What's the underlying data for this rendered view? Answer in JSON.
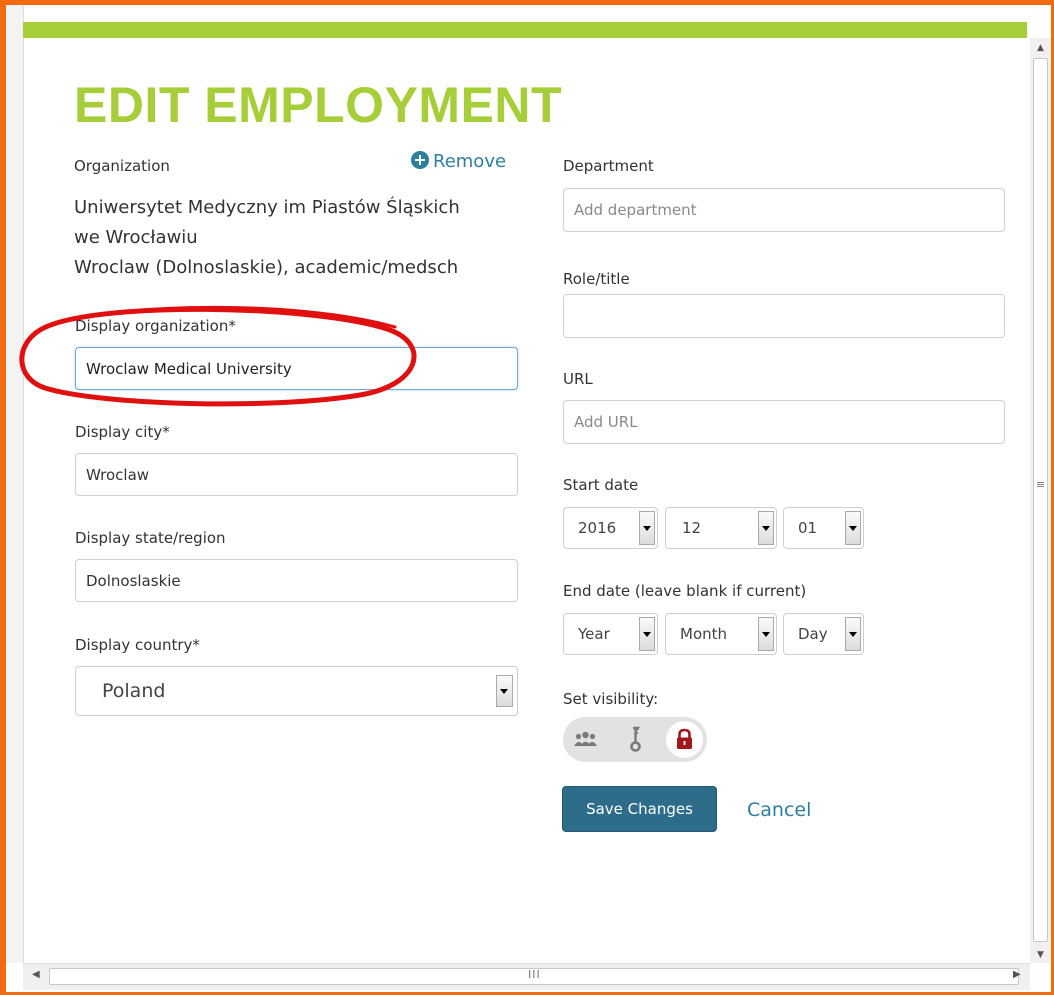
{
  "dialog": {
    "title": "EDIT EMPLOYMENT"
  },
  "organization": {
    "label": "Organization",
    "remove_label": "Remove",
    "name_line1": "Uniwersytet Medyczny im Piastów Śląskich",
    "name_line2": "we Wrocławiu",
    "location_line": "Wroclaw (Dolnoslaskie), academic/medsch"
  },
  "display_organization": {
    "label": "Display organization*",
    "value": "Wroclaw Medical University"
  },
  "display_city": {
    "label": "Display city*",
    "value": "Wroclaw"
  },
  "display_state": {
    "label": "Display state/region",
    "value": "Dolnoslaskie"
  },
  "display_country": {
    "label": "Display country*",
    "value": "Poland"
  },
  "department": {
    "label": "Department",
    "placeholder": "Add department"
  },
  "role": {
    "label": "Role/title",
    "value": ""
  },
  "url": {
    "label": "URL",
    "placeholder": "Add URL"
  },
  "start_date": {
    "label": "Start date",
    "year": "2016",
    "month": "12",
    "day": "01"
  },
  "end_date": {
    "label": "End date (leave blank if current)",
    "year": "Year",
    "month": "Month",
    "day": "Day"
  },
  "visibility": {
    "label": "Set visibility:",
    "options": [
      "everyone-icon",
      "trusted-parties-icon",
      "only-me-lock-icon"
    ],
    "selected": "only-me-lock-icon"
  },
  "actions": {
    "save_label": "Save Changes",
    "cancel_label": "Cancel"
  },
  "colors": {
    "brand_green": "#a6ce39",
    "link_blue": "#2e7f9d",
    "button_blue": "#2e6d8a",
    "frame_orange": "#f26b10",
    "annotation_red": "#e01010",
    "lock_red": "#a0181c"
  }
}
